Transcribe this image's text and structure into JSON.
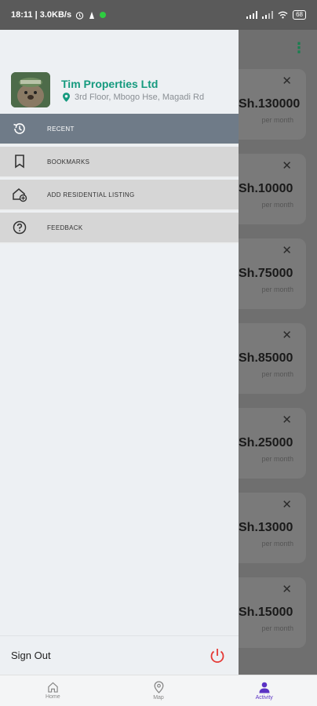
{
  "status_bar": {
    "left_text": "18:11 | 3.0KB/s",
    "battery": "68"
  },
  "profile": {
    "org_name": "Tim Properties Ltd",
    "address": "3rd Floor, Mbogo Hse, Magadi Rd"
  },
  "menu": {
    "items": [
      {
        "label": "RECENT",
        "icon": "history-icon",
        "active": true
      },
      {
        "label": "BOOKMARKS",
        "icon": "bookmark-icon",
        "active": false
      },
      {
        "label": "ADD RESIDENTIAL LISTING",
        "icon": "add-home-icon",
        "active": false
      },
      {
        "label": "FEEDBACK",
        "icon": "help-icon",
        "active": false
      }
    ]
  },
  "signout": {
    "label": "Sign Out"
  },
  "listings": [
    {
      "price": "Sh.130000",
      "period": "per month"
    },
    {
      "price": "Sh.10000",
      "period": "per month"
    },
    {
      "price": "Sh.75000",
      "period": "per month"
    },
    {
      "price": "Sh.85000",
      "period": "per month"
    },
    {
      "price": "Sh.25000",
      "period": "per month"
    },
    {
      "price": "Sh.13000",
      "period": "per month"
    },
    {
      "price": "Sh.15000",
      "period": "per month"
    }
  ],
  "bottom_nav": {
    "tabs": [
      {
        "label": "Home",
        "icon": "home-icon",
        "active": false
      },
      {
        "label": "Map",
        "icon": "map-pin-icon",
        "active": false
      },
      {
        "label": "Activity",
        "icon": "person-icon",
        "active": true
      }
    ]
  },
  "colors": {
    "accent_teal": "#159a7e",
    "active_menu_bg": "#6f7b88",
    "signout_red": "#e53935",
    "nav_active": "#5b32c4"
  }
}
